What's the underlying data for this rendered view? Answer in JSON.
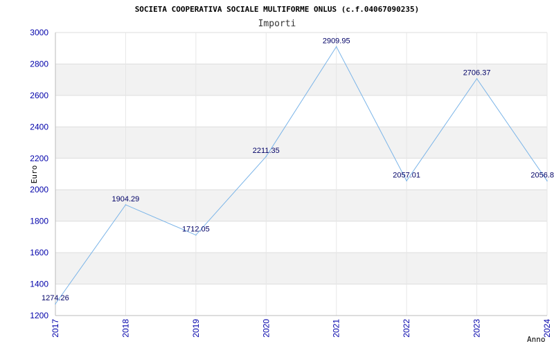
{
  "chart_data": {
    "type": "line",
    "title": "SOCIETA COOPERATIVA SOCIALE MULTIFORME ONLUS (c.f.04067090235)",
    "subtitle": "Importi",
    "xlabel": "Anno",
    "ylabel": "Euro",
    "x": [
      "2017",
      "2018",
      "2019",
      "2020",
      "2021",
      "2022",
      "2023",
      "2024"
    ],
    "values": [
      1274.26,
      1904.29,
      1712.05,
      2211.35,
      2909.95,
      2057.01,
      2706.37,
      2056.8
    ],
    "data_labels": [
      "1274.26",
      "1904.29",
      "1712.05",
      "2211.35",
      "2909.95",
      "2057.01",
      "2706.37",
      "2056.8"
    ],
    "ylim": [
      1200,
      3000
    ],
    "yticks": [
      "1200",
      "1400",
      "1600",
      "1800",
      "2000",
      "2200",
      "2400",
      "2600",
      "2800",
      "3000"
    ],
    "grid": true,
    "colors": {
      "line": "#7ab4e8",
      "band": "#f2f2f2",
      "tick_text": "#0000aa",
      "label_text": "#000066"
    }
  }
}
